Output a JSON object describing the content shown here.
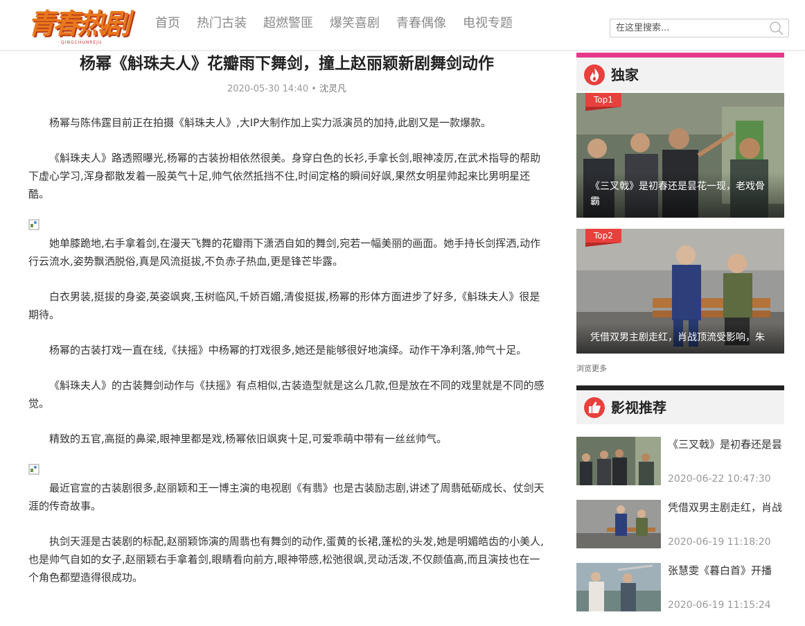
{
  "site": {
    "logo_text": "青春热剧",
    "logo_sub": "QINGCHUNREJU"
  },
  "nav": {
    "items": [
      "首页",
      "热门古装",
      "超燃警匪",
      "爆笑喜剧",
      "青春偶像",
      "电视专题"
    ]
  },
  "search": {
    "placeholder": "在这里搜索..."
  },
  "article": {
    "title": "杨幂《斛珠夫人》花瓣雨下舞剑，撞上赵丽颖新剧舞剑动作",
    "date": "2020-05-30 14:40",
    "separator": "•",
    "author": "沈灵凡",
    "paragraphs": [
      "杨幂与陈伟霆目前正在拍摄《斛珠夫人》,大IP大制作加上实力派演员的加持,此剧又是一款爆款。",
      "《斛珠夫人》路透照曝光,杨幂的古装扮相依然很美。身穿白色的长衫,手拿长剑,眼神凌厉,在武术指导的帮助下虚心学习,浑身都散发着一股英气十足,帅气依然抵挡不住,时间定格的瞬间好飒,果然女明星帅起来比男明星还酷。",
      "她单膝跪地,右手拿着剑,在漫天飞舞的花瓣雨下潇洒自如的舞剑,宛若一幅美丽的画面。她手持长剑挥洒,动作行云流水,姿势飘洒脱俗,真是风流挺拔,不负赤子热血,更是锋芒毕露。",
      "白衣男装,挺拔的身姿,英姿飒爽,玉树临风,千娇百媚,清俊挺拔,杨幂的形体方面进步了好多,《斛珠夫人》很是期待。",
      "杨幂的古装打戏一直在线,《扶摇》中杨幂的打戏很多,她还是能够很好地演绎。动作干净利落,帅气十足。",
      "《斛珠夫人》的古装舞剑动作与《扶摇》有点相似,古装造型就是这么几款,但是放在不同的戏里就是不同的感觉。",
      "精致的五官,高挺的鼻梁,眼神里都是戏,杨幂依旧飒爽十足,可爱乖萌中带有一丝丝帅气。",
      "最近官宣的古装剧很多,赵丽颖和王一博主演的电视剧《有翡》也是古装励志剧,讲述了周翡砥砺成长、仗剑天涯的传奇故事。",
      "执剑天涯是古装剧的标配,赵丽颖饰演的周翡也有舞剑的动作,蛋黄的长裙,蓬松的头发,她是明媚皓齿的小美人,也是帅气自如的女子,赵丽颖右手拿着剑,眼睛看向前方,眼神带感,松弛很飒,灵动活泼,不仅颜值高,而且演技也在一个角色都塑造得很成功。"
    ]
  },
  "sidebar": {
    "exclusive": {
      "heading": "独家",
      "items": [
        {
          "tag": "Top1",
          "caption": "《三叉戟》是初春还是昙花一现，老戏骨霸"
        },
        {
          "tag": "Top2",
          "caption": "凭借双男主剧走红，肖战顶流受影响，朱"
        }
      ],
      "more": "浏览更多"
    },
    "recommend": {
      "heading": "影视推荐",
      "items": [
        {
          "title": "《三叉戟》是初春还是昙",
          "date": "2020-06-22 10:47:30"
        },
        {
          "title": "凭借双男主剧走红，肖战",
          "date": "2020-06-19 11:18:20"
        },
        {
          "title": "张慧雯《暮白首》开播",
          "date": "2020-06-19 11:15:24"
        }
      ]
    }
  },
  "colors": {
    "accent_pink": "#e6398a",
    "tag_red": "#e8403d",
    "logo_orange": "#e8771c",
    "icon_red": "#e8403d"
  }
}
